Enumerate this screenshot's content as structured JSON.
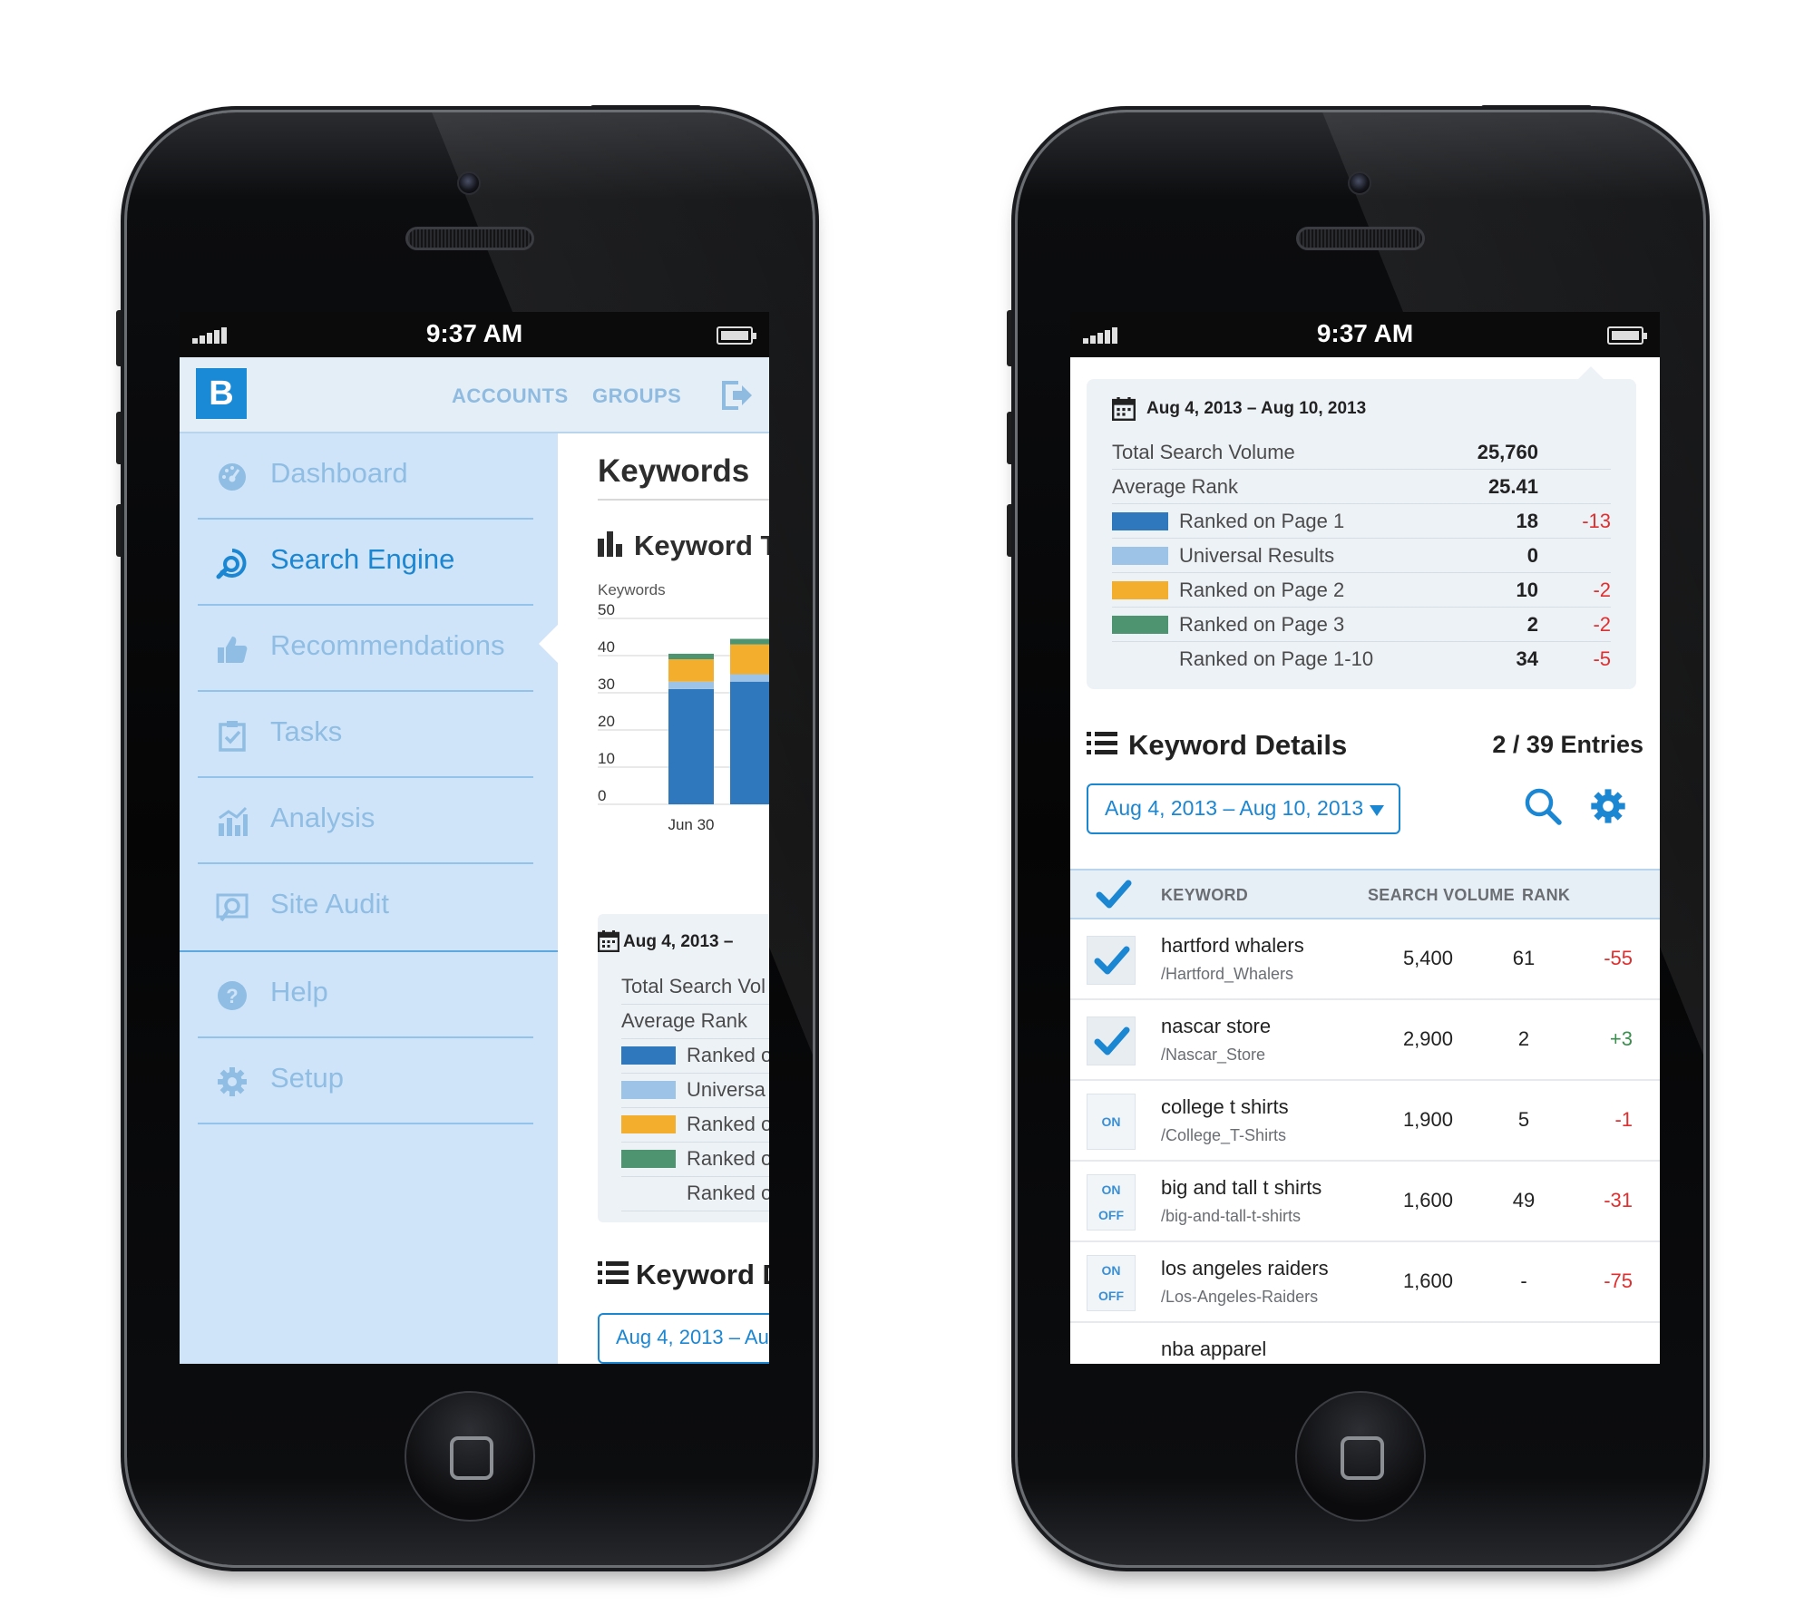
{
  "colors": {
    "accent": "#1b86d2",
    "sidebar_bg": "#cfe4f8",
    "ranked_page1": "#2f78bd",
    "universal": "#9dc3e6",
    "ranked_page2": "#f2ae2c",
    "ranked_page3": "#4e9470",
    "negative": "#e12f2f",
    "positive": "#3a8f4e"
  },
  "status_bar": {
    "time": "9:37 AM"
  },
  "left_phone": {
    "logo": "B",
    "topnav": {
      "accounts": "ACCOUNTS",
      "groups": "GROUPS"
    },
    "menu": [
      {
        "label": "Dashboard",
        "icon": "dashboard-gauge-icon"
      },
      {
        "label": "Search Engine",
        "icon": "search-engine-icon",
        "active": true
      },
      {
        "label": "Recommendations",
        "icon": "thumbs-up-icon"
      },
      {
        "label": "Tasks",
        "icon": "clipboard-check-icon"
      },
      {
        "label": "Analysis",
        "icon": "analysis-chart-icon"
      },
      {
        "label": "Site Audit",
        "icon": "site-audit-icon"
      },
      {
        "label": "Help",
        "icon": "help-icon"
      },
      {
        "label": "Setup",
        "icon": "gear-icon"
      }
    ],
    "content": {
      "title": "Keywords",
      "chart_heading": "Keyword T",
      "date_short": "Aug 4, 2013 –",
      "summary_rows": [
        "Total Search Vol",
        "Average Rank",
        "Ranked o",
        "Universa",
        "Ranked o",
        "Ranked o",
        "Ranked o"
      ],
      "details_heading": "Keyword D",
      "date_select": "Aug 4, 2013 – Au"
    }
  },
  "chart_data": {
    "type": "bar",
    "ylabel": "Keywords",
    "ylim": [
      0,
      50
    ],
    "yticks": [
      "50",
      "40",
      "30",
      "20",
      "10",
      "0"
    ],
    "categories": [
      "Jun 30",
      ""
    ],
    "series": [
      {
        "name": "Ranked on Page 1",
        "values": [
          31,
          33
        ]
      },
      {
        "name": "Universal Results",
        "values": [
          2,
          2
        ]
      },
      {
        "name": "Ranked on Page 2",
        "values": [
          6,
          8
        ]
      },
      {
        "name": "Ranked on Page 3",
        "values": [
          1.5,
          1.5
        ]
      }
    ]
  },
  "right_phone": {
    "summary": {
      "date_range": "Aug 4, 2013 – Aug 10, 2013",
      "rows": [
        {
          "label": "Total Search Volume",
          "value": "25,760",
          "change": ""
        },
        {
          "label": "Average Rank",
          "value": "25.41",
          "change": ""
        },
        {
          "label": "Ranked on Page 1",
          "value": "18",
          "change": "-13"
        },
        {
          "label": "Universal Results",
          "value": "0",
          "change": ""
        },
        {
          "label": "Ranked on Page 2",
          "value": "10",
          "change": "-2"
        },
        {
          "label": "Ranked on Page 3",
          "value": "2",
          "change": "-2"
        },
        {
          "label": "Ranked on Page 1-10",
          "value": "34",
          "change": "-5"
        }
      ]
    },
    "details": {
      "title": "Keyword Details",
      "entries": "2 / 39 Entries",
      "date_select": "Aug 4, 2013 – Aug 10, 2013",
      "columns": {
        "keyword": "KEYWORD",
        "volume": "SEARCH VOLUME",
        "rank": "RANK"
      },
      "rows": [
        {
          "keyword": "hartford whalers",
          "path": "/Hartford_Whalers",
          "volume": "5,400",
          "rank": "61",
          "change": "-55",
          "state": "checked"
        },
        {
          "keyword": "nascar store",
          "path": "/Nascar_Store",
          "volume": "2,900",
          "rank": "2",
          "change": "+3",
          "state": "checked"
        },
        {
          "keyword": "college t shirts",
          "path": "/College_T-Shirts",
          "volume": "1,900",
          "rank": "5",
          "change": "-1",
          "state": "on"
        },
        {
          "keyword": "big and tall t shirts",
          "path": "/big-and-tall-t-shirts",
          "volume": "1,600",
          "rank": "49",
          "change": "-31",
          "state": "onoff"
        },
        {
          "keyword": "los angeles raiders",
          "path": "/Los-Angeles-Raiders",
          "volume": "1,600",
          "rank": "-",
          "change": "-75",
          "state": "onoff"
        },
        {
          "keyword": "nba apparel",
          "path": "",
          "volume": "",
          "rank": "",
          "change": "",
          "state": "partial"
        }
      ],
      "toggle_on": "ON",
      "toggle_off": "OFF"
    }
  }
}
